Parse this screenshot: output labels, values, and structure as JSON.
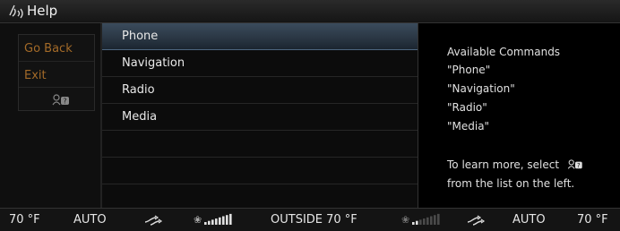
{
  "header": {
    "title": "Help",
    "icon": "voice-command-icon"
  },
  "left_menu": {
    "items": [
      {
        "label": "Go Back"
      },
      {
        "label": "Exit"
      }
    ],
    "help_icon": "voice-help-icon",
    "label_color": "#a36a28"
  },
  "main_list": {
    "items": [
      {
        "label": "Phone",
        "selected": true
      },
      {
        "label": "Navigation",
        "selected": false
      },
      {
        "label": "Radio",
        "selected": false
      },
      {
        "label": "Media",
        "selected": false
      },
      {
        "label": "",
        "selected": false
      },
      {
        "label": "",
        "selected": false
      }
    ],
    "selected_color": "#3b4b5c"
  },
  "info_panel": {
    "heading": "Available Commands",
    "commands": [
      "\"Phone\"",
      "\"Navigation\"",
      "\"Radio\"",
      "\"Media\""
    ],
    "hint_line1": "To learn more, select",
    "hint_line2": "from the list on the left.",
    "hint_icon": "voice-help-icon"
  },
  "status_bar": {
    "left_temp": "70 °F",
    "left_mode": "AUTO",
    "left_airflow_icon": "airflow-icon",
    "left_fan_icon": "fan-speed-icon",
    "left_fan_level": 1.0,
    "outside": "OUTSIDE  70 °F",
    "right_fan_icon": "fan-speed-icon",
    "right_fan_level": 0.2,
    "right_airflow_icon": "airflow-icon",
    "right_mode": "AUTO",
    "right_temp": "70 °F"
  }
}
